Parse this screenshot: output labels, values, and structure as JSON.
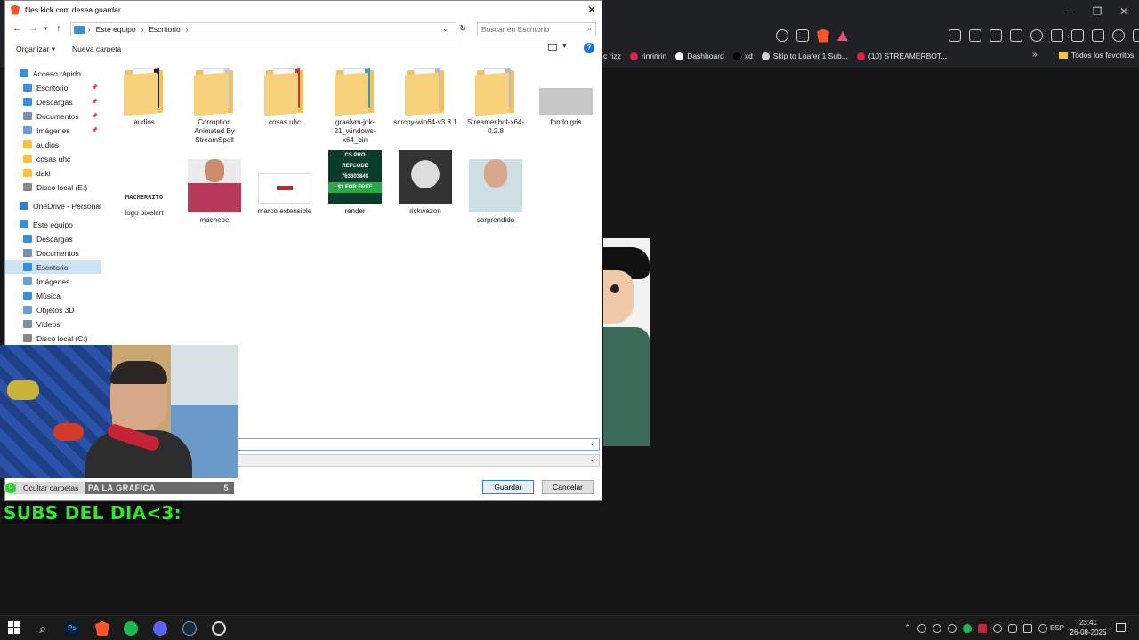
{
  "dialog": {
    "title": "files.kick.com desea guardar",
    "breadcrumbs": [
      "Este equipo",
      "Escritorio"
    ],
    "search_placeholder": "Buscar en Escritorio",
    "organize_label": "Organizar",
    "new_folder_label": "Nueva carpeta",
    "nav_items": [
      {
        "label": "Acceso rápido",
        "pinned": false
      },
      {
        "label": "Escritorio",
        "pinned": true
      },
      {
        "label": "Descargas",
        "pinned": true
      },
      {
        "label": "Documentos",
        "pinned": true
      },
      {
        "label": "Imágenes",
        "pinned": true
      },
      {
        "label": "audios",
        "pinned": false
      },
      {
        "label": "cosas uhc",
        "pinned": false
      },
      {
        "label": "daki",
        "pinned": false
      },
      {
        "label": "Disco local (E:)",
        "pinned": false
      },
      {
        "label": "OneDrive - Personal",
        "pinned": false
      },
      {
        "label": "Este equipo",
        "pinned": false
      },
      {
        "label": "Descargas",
        "pinned": false
      },
      {
        "label": "Documentos",
        "pinned": false
      },
      {
        "label": "Escritorio",
        "pinned": false,
        "selected": true
      },
      {
        "label": "Imágenes",
        "pinned": false
      },
      {
        "label": "Música",
        "pinned": false
      },
      {
        "label": "Objetos 3D",
        "pinned": false
      },
      {
        "label": "Vídeos",
        "pinned": false
      },
      {
        "label": "Disco local (C:)",
        "pinned": false
      }
    ],
    "files": [
      {
        "name": "audios",
        "kind": "folder"
      },
      {
        "name": "Corruption Animated By StreamSpell",
        "kind": "folder"
      },
      {
        "name": "cosas uhc",
        "kind": "folder"
      },
      {
        "name": "graalvm-jdk-21_windows-x64_bin",
        "kind": "folder"
      },
      {
        "name": "scrcpy-win64-v3.3.1",
        "kind": "folder"
      },
      {
        "name": "Streamer.bot-x64-0.2.8",
        "kind": "folder"
      },
      {
        "name": "fondo gris",
        "kind": "image"
      },
      {
        "name": "logo pixelart",
        "kind": "image"
      },
      {
        "name": "machepe",
        "kind": "image"
      },
      {
        "name": "marco extensible",
        "kind": "image"
      },
      {
        "name": "render",
        "kind": "image"
      },
      {
        "name": "rickwazon",
        "kind": "image"
      },
      {
        "name": "sorprendido",
        "kind": "image"
      }
    ],
    "render_thumb_text": [
      "CS.PRO",
      "REFCODE",
      "763603849",
      "$1 FOR FREE"
    ],
    "logo_thumb_text": "MACHERRITO",
    "filename_value": "",
    "filetype_value": "",
    "save_label": "Guardar",
    "cancel_label": "Cancelar"
  },
  "browser": {
    "bookmarks": [
      {
        "label": "c rizz",
        "color": "#888888"
      },
      {
        "label": "rinrinrin",
        "color": "#e62143"
      },
      {
        "label": "Dashboard",
        "color": "#ffffff"
      },
      {
        "label": "xd",
        "color": "#000000"
      },
      {
        "label": "Skip to Loafer 1 Sub...",
        "color": "#cfcfcf"
      },
      {
        "label": "(10) STREAMERBOT...",
        "color": "#e62143"
      }
    ],
    "all_favorites_label": "Todos los favoritos"
  },
  "overlay": {
    "hide_folders_count": "0",
    "hide_folders_label": "Ocultar carpetas",
    "goal_label": "PA LA GRAFICA",
    "goal_value": "5",
    "subs_label": "SUBS DEL DIA<3:"
  },
  "taskbar": {
    "apps": [
      "windows-start",
      "search",
      "photoshop",
      "brave",
      "spotify",
      "discord",
      "steam",
      "obs"
    ],
    "photoshop_label": "Ps",
    "language": "ESP",
    "time": "23:41",
    "date": "26-08-2025"
  },
  "colors": {
    "accent": "#0078d7",
    "folder": "#f2c35a",
    "subs_green": "#2ee82e",
    "brave_orange": "#fb542b"
  }
}
